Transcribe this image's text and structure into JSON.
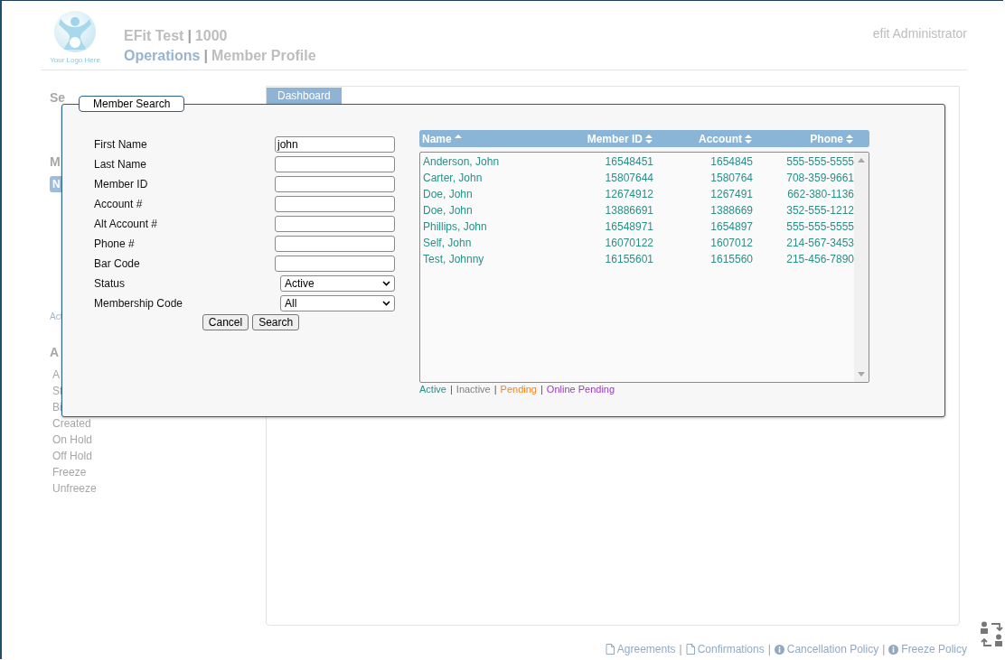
{
  "header": {
    "logo_text": "Your Logo Here",
    "company": "EFit Test",
    "company_id": "1000",
    "section": "Operations",
    "page": "Member Profile",
    "separator": "|",
    "user": "efit Administrator"
  },
  "tabs": [
    {
      "label": "Dashboard",
      "selected": true
    }
  ],
  "sidebar": [
    {
      "kind": "heading",
      "text": "Se"
    },
    {
      "kind": "heading",
      "text": "M"
    },
    {
      "kind": "button",
      "text": "N"
    },
    {
      "kind": "note",
      "text": "Act"
    },
    {
      "kind": "heading",
      "text": "A"
    },
    {
      "kind": "item",
      "text": "A"
    },
    {
      "kind": "item",
      "text": "St"
    },
    {
      "kind": "item",
      "text": "Bi"
    },
    {
      "kind": "item",
      "text": "Created"
    },
    {
      "kind": "item",
      "text": "On Hold"
    },
    {
      "kind": "item",
      "text": "Off Hold"
    },
    {
      "kind": "item",
      "text": "Freeze"
    },
    {
      "kind": "item",
      "text": "Unfreeze"
    }
  ],
  "modal": {
    "title": "Member Search",
    "fields": [
      {
        "kind": "text",
        "label": "First Name",
        "value": "john"
      },
      {
        "kind": "text",
        "label": "Last Name"
      },
      {
        "kind": "text",
        "label": "Member ID"
      },
      {
        "kind": "text",
        "label": "Account #"
      },
      {
        "kind": "text",
        "label": "Alt Account #"
      },
      {
        "kind": "text",
        "label": "Phone #"
      },
      {
        "kind": "text",
        "label": "Bar Code"
      },
      {
        "kind": "select",
        "label": "Status",
        "value": "Active"
      },
      {
        "kind": "select",
        "label": "Membership Code",
        "value": "All"
      }
    ],
    "buttons": [
      "Cancel",
      "Search"
    ],
    "table": {
      "columns": [
        {
          "label": "Name",
          "sorted": true
        },
        {
          "label": "Member ID",
          "sorted": false
        },
        {
          "label": "Account",
          "sorted": false
        },
        {
          "label": "Phone",
          "sorted": false
        }
      ],
      "rows": [
        [
          "Anderson, John",
          "16548451",
          "1654845",
          "555-555-5555"
        ],
        [
          "Carter, John",
          "15807644",
          "1580764",
          "708-359-9661"
        ],
        [
          "Doe, John",
          "12674912",
          "1267491",
          "662-380-1136"
        ],
        [
          "Doe, John",
          "13886691",
          "1388669",
          "352-555-1212"
        ],
        [
          "Phillips, John",
          "16548971",
          "1654897",
          "555-555-5555"
        ],
        [
          "Self, John",
          "16070122",
          "1607012",
          "214-567-3453"
        ],
        [
          "Test, Johnny",
          "16155601",
          "1615560",
          "215-456-7890"
        ]
      ]
    },
    "legend": {
      "separator": "|",
      "items": [
        {
          "label": "Active",
          "color": "#2a8f87"
        },
        {
          "label": "Inactive",
          "color": "#808080"
        },
        {
          "label": "Pending",
          "color": "#f0862a"
        },
        {
          "label": "Online Pending",
          "color": "#9b3cc4"
        }
      ]
    }
  },
  "footer": {
    "separator": "|",
    "links": [
      {
        "kind": "pdf",
        "label": "Agreements"
      },
      {
        "kind": "pdf",
        "label": "Confirmations"
      },
      {
        "kind": "info",
        "label": "Cancellation Policy"
      },
      {
        "kind": "info",
        "label": "Freeze Policy"
      }
    ]
  }
}
